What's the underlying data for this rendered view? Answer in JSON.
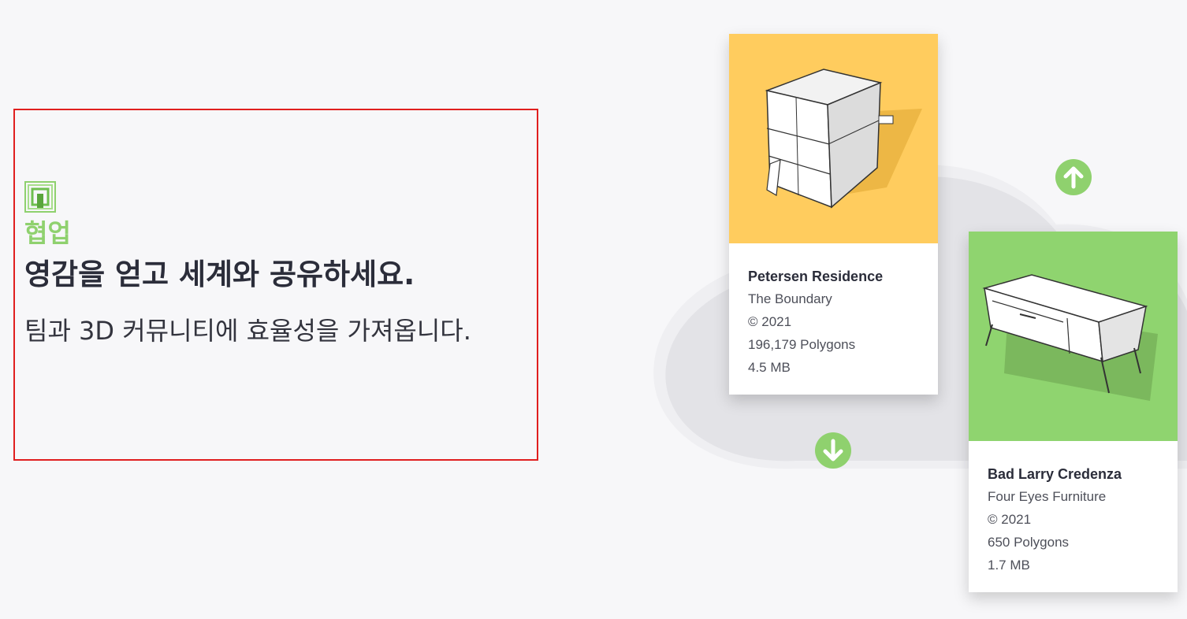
{
  "intro": {
    "eyebrow": "협업",
    "headline": "영감을 얻고 세계와 공유하세요.",
    "lead": "팀과 3D 커뮤니티에 효율성을 가져옵니다."
  },
  "cards": [
    {
      "title": "Petersen Residence",
      "author": "The Boundary",
      "copyright": "© 2021",
      "polygons": "196,179 Polygons",
      "size": "4.5 MB"
    },
    {
      "title": "Bad Larry Credenza",
      "author": "Four Eyes Furniture",
      "copyright": "© 2021",
      "polygons": "650 Polygons",
      "size": "1.7 MB"
    }
  ],
  "colors": {
    "accent_green": "#8fd16e",
    "card_yellow": "#ffcc5e",
    "card_green": "#8fd46f",
    "highlight_border": "#e01f1f"
  },
  "icons": {
    "logo": "collaboration-logo-icon",
    "upload": "arrow-up-circle-icon",
    "download": "arrow-down-circle-icon"
  }
}
